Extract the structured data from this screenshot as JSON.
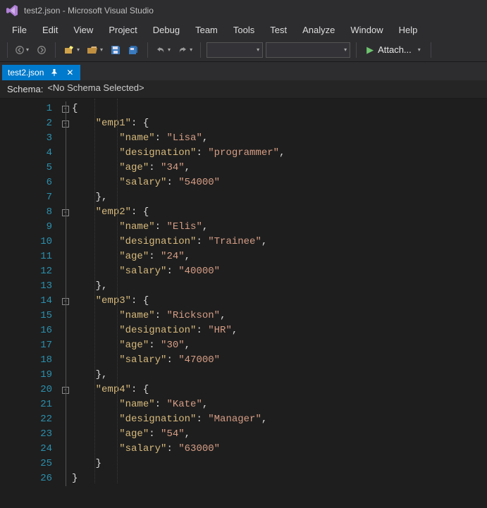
{
  "window": {
    "title": "test2.json - Microsoft Visual Studio"
  },
  "menu": {
    "items": [
      "File",
      "Edit",
      "View",
      "Project",
      "Debug",
      "Team",
      "Tools",
      "Test",
      "Analyze",
      "Window",
      "Help"
    ]
  },
  "toolbar": {
    "attach_label": "Attach..."
  },
  "tab": {
    "name": "test2.json"
  },
  "schema": {
    "label": "Schema:",
    "value": "<No Schema Selected>"
  },
  "code": {
    "line_count": 26,
    "fold_rows": [
      1,
      2,
      8,
      14,
      20
    ],
    "lines": [
      {
        "indent": 0,
        "tokens": [
          [
            "brace",
            "{"
          ]
        ]
      },
      {
        "indent": 1,
        "tokens": [
          [
            "key",
            "\"emp1\""
          ],
          [
            "punc",
            ": "
          ],
          [
            "brace",
            "{"
          ]
        ]
      },
      {
        "indent": 2,
        "tokens": [
          [
            "key",
            "\"name\""
          ],
          [
            "punc",
            ": "
          ],
          [
            "str",
            "\"Lisa\""
          ],
          [
            "punc",
            ","
          ]
        ]
      },
      {
        "indent": 2,
        "tokens": [
          [
            "key",
            "\"designation\""
          ],
          [
            "punc",
            ": "
          ],
          [
            "str",
            "\"programmer\""
          ],
          [
            "punc",
            ","
          ]
        ]
      },
      {
        "indent": 2,
        "tokens": [
          [
            "key",
            "\"age\""
          ],
          [
            "punc",
            ": "
          ],
          [
            "str",
            "\"34\""
          ],
          [
            "punc",
            ","
          ]
        ]
      },
      {
        "indent": 2,
        "tokens": [
          [
            "key",
            "\"salary\""
          ],
          [
            "punc",
            ": "
          ],
          [
            "str",
            "\"54000\""
          ]
        ]
      },
      {
        "indent": 1,
        "tokens": [
          [
            "brace",
            "}"
          ],
          [
            "punc",
            ","
          ]
        ]
      },
      {
        "indent": 1,
        "tokens": [
          [
            "key",
            "\"emp2\""
          ],
          [
            "punc",
            ": "
          ],
          [
            "brace",
            "{"
          ]
        ]
      },
      {
        "indent": 2,
        "tokens": [
          [
            "key",
            "\"name\""
          ],
          [
            "punc",
            ": "
          ],
          [
            "str",
            "\"Elis\""
          ],
          [
            "punc",
            ","
          ]
        ]
      },
      {
        "indent": 2,
        "tokens": [
          [
            "key",
            "\"designation\""
          ],
          [
            "punc",
            ": "
          ],
          [
            "str",
            "\"Trainee\""
          ],
          [
            "punc",
            ","
          ]
        ]
      },
      {
        "indent": 2,
        "tokens": [
          [
            "key",
            "\"age\""
          ],
          [
            "punc",
            ": "
          ],
          [
            "str",
            "\"24\""
          ],
          [
            "punc",
            ","
          ]
        ]
      },
      {
        "indent": 2,
        "tokens": [
          [
            "key",
            "\"salary\""
          ],
          [
            "punc",
            ": "
          ],
          [
            "str",
            "\"40000\""
          ]
        ]
      },
      {
        "indent": 1,
        "tokens": [
          [
            "brace",
            "}"
          ],
          [
            "punc",
            ","
          ]
        ]
      },
      {
        "indent": 1,
        "tokens": [
          [
            "key",
            "\"emp3\""
          ],
          [
            "punc",
            ": "
          ],
          [
            "brace",
            "{"
          ]
        ]
      },
      {
        "indent": 2,
        "tokens": [
          [
            "key",
            "\"name\""
          ],
          [
            "punc",
            ": "
          ],
          [
            "str",
            "\"Rickson\""
          ],
          [
            "punc",
            ","
          ]
        ]
      },
      {
        "indent": 2,
        "tokens": [
          [
            "key",
            "\"designation\""
          ],
          [
            "punc",
            ": "
          ],
          [
            "str",
            "\"HR\""
          ],
          [
            "punc",
            ","
          ]
        ]
      },
      {
        "indent": 2,
        "tokens": [
          [
            "key",
            "\"age\""
          ],
          [
            "punc",
            ": "
          ],
          [
            "str",
            "\"30\""
          ],
          [
            "punc",
            ","
          ]
        ]
      },
      {
        "indent": 2,
        "tokens": [
          [
            "key",
            "\"salary\""
          ],
          [
            "punc",
            ": "
          ],
          [
            "str",
            "\"47000\""
          ]
        ]
      },
      {
        "indent": 1,
        "tokens": [
          [
            "brace",
            "}"
          ],
          [
            "punc",
            ","
          ]
        ]
      },
      {
        "indent": 1,
        "tokens": [
          [
            "key",
            "\"emp4\""
          ],
          [
            "punc",
            ": "
          ],
          [
            "brace",
            "{"
          ]
        ]
      },
      {
        "indent": 2,
        "tokens": [
          [
            "key",
            "\"name\""
          ],
          [
            "punc",
            ": "
          ],
          [
            "str",
            "\"Kate\""
          ],
          [
            "punc",
            ","
          ]
        ]
      },
      {
        "indent": 2,
        "tokens": [
          [
            "key",
            "\"designation\""
          ],
          [
            "punc",
            ": "
          ],
          [
            "str",
            "\"Manager\""
          ],
          [
            "punc",
            ","
          ]
        ]
      },
      {
        "indent": 2,
        "tokens": [
          [
            "key",
            "\"age\""
          ],
          [
            "punc",
            ": "
          ],
          [
            "str",
            "\"54\""
          ],
          [
            "punc",
            ","
          ]
        ]
      },
      {
        "indent": 2,
        "tokens": [
          [
            "key",
            "\"salary\""
          ],
          [
            "punc",
            ": "
          ],
          [
            "str",
            "\"63000\""
          ]
        ]
      },
      {
        "indent": 1,
        "tokens": [
          [
            "brace",
            "}"
          ]
        ]
      },
      {
        "indent": 0,
        "tokens": [
          [
            "brace",
            "}"
          ]
        ]
      }
    ]
  }
}
